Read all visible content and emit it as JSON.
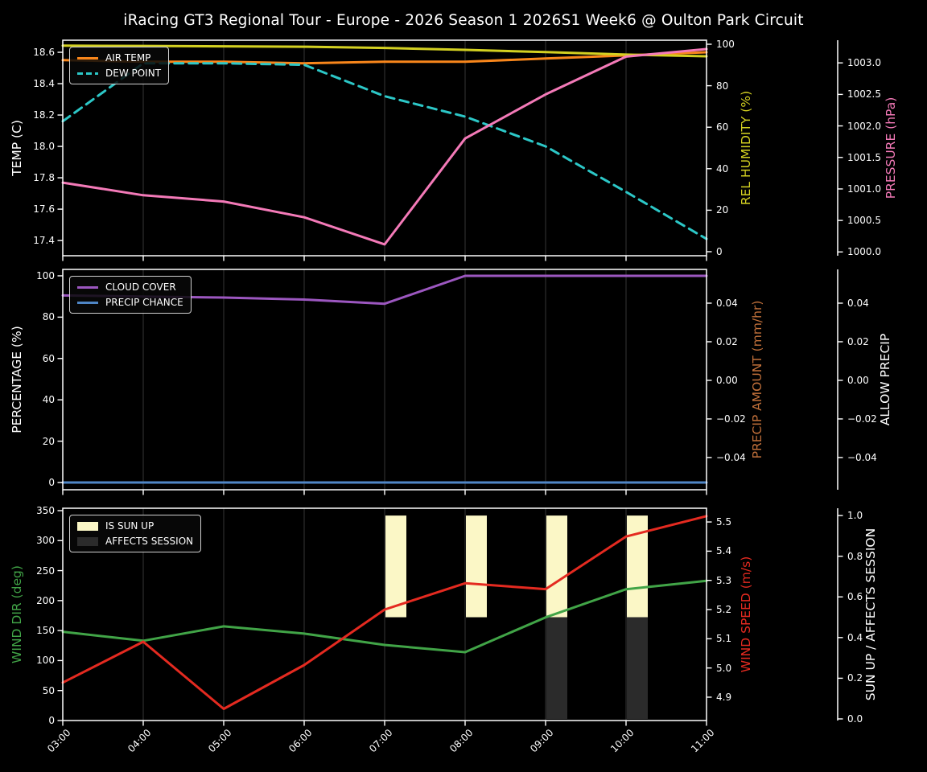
{
  "title": "iRacing GT3 Regional Tour - Europe - 2026 Season 1 2026S1 Week6 @ Oulton Park Circuit",
  "colors": {
    "background": "#000000",
    "text": "#ffffff",
    "grid": "#2a2a2a",
    "spine": "#ffffff",
    "air_temp": "#f8861b",
    "dew_point": "#2cc7c7",
    "humidity": "#d3d021",
    "pressure": "#f47ab8",
    "cloud_cover": "#9c57c0",
    "precip_chance": "#4f86c6",
    "precip_amount": "#c1703a",
    "wind_dir": "#41a447",
    "wind_speed": "#e42a20",
    "sun_up": "#fbf7c6",
    "affects_session": "#2b2b2b"
  },
  "chart_data": {
    "type": "line",
    "x_labels": [
      "03:00",
      "04:00",
      "05:00",
      "06:00",
      "07:00",
      "08:00",
      "09:00",
      "10:00",
      "11:00"
    ],
    "plots": [
      {
        "y_axes": [
          {
            "id": "temp",
            "side": "left",
            "label": "TEMP (C)",
            "color": "#ffffff",
            "tick_values": [
              18.6,
              18.4,
              18.2,
              18.0,
              17.8,
              17.6,
              17.4
            ],
            "tick_labels": [
              "18.6",
              "18.4",
              "18.2",
              "18.0",
              "17.8",
              "17.6",
              "17.4"
            ]
          },
          {
            "id": "hum",
            "side": "right",
            "label": "REL HUMIDITY (%)",
            "color": "#d3d021",
            "tick_values": [
              100,
              80,
              60,
              40,
              20,
              0
            ],
            "tick_labels": [
              "100",
              "80",
              "60",
              "40",
              "20",
              "0"
            ]
          },
          {
            "id": "pres",
            "side": "right2",
            "label": "PRESSURE (hPa)",
            "color": "#f47ab8",
            "tick_values": [
              1003.0,
              1002.5,
              1002.0,
              1001.5,
              1001.0,
              1000.5,
              1000.0
            ],
            "tick_labels": [
              "1003.0",
              "1002.5",
              "1002.0",
              "1001.5",
              "1001.0",
              "1000.5",
              "1000.0"
            ]
          }
        ],
        "series": [
          {
            "name": "AIR TEMP",
            "axis": "temp",
            "color": "#f8861b",
            "line": "solid",
            "legend": true,
            "values": [
              18.55,
              18.54,
              18.54,
              18.53,
              18.54,
              18.54,
              18.56,
              18.58,
              18.6
            ]
          },
          {
            "name": "DEW POINT",
            "axis": "temp",
            "color": "#2cc7c7",
            "line": "dashed",
            "legend": true,
            "values": [
              18.16,
              18.53,
              18.53,
              18.52,
              18.32,
              18.19,
              18.0,
              17.71,
              17.41
            ]
          },
          {
            "name": "REL HUMIDITY",
            "axis": "hum",
            "color": "#d3d021",
            "line": "solid",
            "legend": false,
            "values": [
              99.3,
              99.2,
              99.0,
              98.8,
              98.2,
              97.3,
              96.2,
              95.0,
              94.2
            ]
          },
          {
            "name": "PRESSURE",
            "axis": "pres",
            "color": "#f47ab8",
            "line": "solid",
            "legend": false,
            "values": [
              1001.1,
              1000.9,
              1000.8,
              1000.55,
              1000.12,
              1001.8,
              1002.5,
              1003.1,
              1003.22
            ]
          }
        ],
        "bars": []
      },
      {
        "y_axes": [
          {
            "id": "pct",
            "side": "left",
            "label": "PERCENTAGE (%)",
            "color": "#ffffff",
            "tick_values": [
              100,
              80,
              60,
              40,
              20,
              0
            ],
            "tick_labels": [
              "100",
              "80",
              "60",
              "40",
              "20",
              "0"
            ]
          },
          {
            "id": "precip",
            "side": "right",
            "label": "PRECIP AMOUNT (mm/hr)",
            "color": "#c1703a",
            "tick_values": [
              0.04,
              0.02,
              0.0,
              -0.02,
              -0.04
            ],
            "tick_labels": [
              "0.04",
              "0.02",
              "0.00",
              "−0.02",
              "−0.04"
            ]
          },
          {
            "id": "allow",
            "side": "right2",
            "label": "ALLOW PRECIP",
            "color": "#ffffff",
            "tick_values": [
              0.04,
              0.02,
              0.0,
              -0.02,
              -0.04
            ],
            "tick_labels": [
              "0.04",
              "0.02",
              "0.00",
              "−0.02",
              "−0.04"
            ]
          }
        ],
        "series": [
          {
            "name": "CLOUD COVER",
            "axis": "pct",
            "color": "#9c57c0",
            "line": "solid",
            "legend": true,
            "values": [
              90.5,
              90,
              89.5,
              88.5,
              86.5,
              100,
              100,
              100,
              100
            ]
          },
          {
            "name": "PRECIP CHANCE",
            "axis": "pct",
            "color": "#4f86c6",
            "line": "solid",
            "legend": true,
            "values": [
              0,
              0,
              0,
              0,
              0,
              0,
              0,
              0,
              0
            ]
          }
        ],
        "bars": []
      },
      {
        "y_axes": [
          {
            "id": "dir",
            "side": "left",
            "label": "WIND DIR (deg)",
            "color": "#41a447",
            "tick_values": [
              350,
              300,
              250,
              200,
              150,
              100,
              50,
              0
            ],
            "tick_labels": [
              "350",
              "300",
              "250",
              "200",
              "150",
              "100",
              "50",
              "0"
            ]
          },
          {
            "id": "speed",
            "side": "right",
            "label": "WIND SPEED (m/s)",
            "color": "#e42a20",
            "tick_values": [
              5.5,
              5.4,
              5.3,
              5.2,
              5.1,
              5.0,
              4.9
            ],
            "tick_labels": [
              "5.5",
              "5.4",
              "5.3",
              "5.2",
              "5.1",
              "5.0",
              "4.9"
            ]
          },
          {
            "id": "sun",
            "side": "right2",
            "label": "SUN UP / AFFECTS SESSION",
            "color": "#ffffff",
            "tick_values": [
              1.0,
              0.8,
              0.6,
              0.4,
              0.2,
              0.0
            ],
            "tick_labels": [
              "1.0",
              "0.8",
              "0.6",
              "0.4",
              "0.2",
              "0.0"
            ]
          }
        ],
        "series": [
          {
            "name": "WIND DIR",
            "axis": "dir",
            "color": "#41a447",
            "line": "solid",
            "legend": false,
            "values": [
              148,
              133,
              157,
              145,
              126,
              114,
              172,
              219,
              233
            ]
          },
          {
            "name": "WIND SPEED",
            "axis": "speed",
            "color": "#e42a20",
            "line": "solid",
            "legend": false,
            "values": [
              4.95,
              5.09,
              4.86,
              5.01,
              5.2,
              5.29,
              5.27,
              5.45,
              5.52
            ]
          }
        ],
        "bars": [
          {
            "name": "IS SUN UP",
            "axis": "sun",
            "color": "#fbf7c6",
            "band": [
              0.5,
              1.0
            ],
            "active": [
              false,
              false,
              false,
              false,
              true,
              true,
              true,
              true,
              false
            ]
          },
          {
            "name": "AFFECTS SESSION",
            "axis": "sun",
            "color": "#2b2b2b",
            "band": [
              0.0,
              0.5
            ],
            "active": [
              false,
              false,
              false,
              false,
              false,
              false,
              true,
              true,
              false
            ]
          }
        ]
      }
    ]
  }
}
